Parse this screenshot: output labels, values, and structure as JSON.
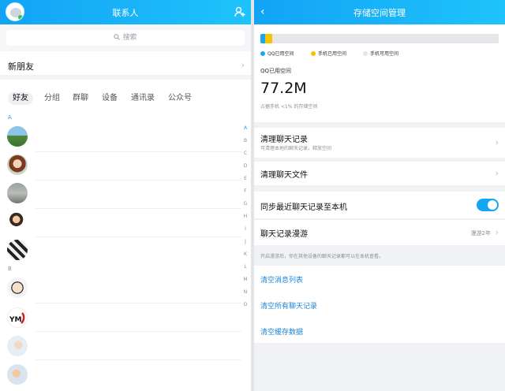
{
  "contacts": {
    "title": "联系人",
    "search_placeholder": "搜索",
    "new_friends": "新朋友",
    "tabs": [
      "好友",
      "分组",
      "群聊",
      "设备",
      "通讯录",
      "公众号"
    ],
    "sections": [
      "A",
      "B"
    ],
    "index_letters": [
      "A",
      "B",
      "C",
      "D",
      "E",
      "F",
      "G",
      "H",
      "I",
      "J",
      "K",
      "L",
      "M",
      "N",
      "O"
    ]
  },
  "storage": {
    "title": "存储空间管理",
    "legend": [
      "QQ已用空间",
      "手机已用空间",
      "手机可用空间"
    ],
    "usage": {
      "qq_fraction": 0.02,
      "phone_used_fraction": 0.03
    },
    "colors": {
      "qq": "#1aa7f2",
      "phone_used": "#f5c400",
      "phone_free": "#e4e6e9"
    },
    "qq_used_label": "QQ已用空间",
    "qq_used_value": "77.2M",
    "qq_used_note": "占据手机 <1% 的存储空间",
    "clear_chat_records": {
      "title": "清理聊天记录",
      "subtitle": "可清理本地的聊天记录，释放空间"
    },
    "clear_chat_files": {
      "title": "清理聊天文件"
    },
    "sync_recent": {
      "title": "同步最近聊天记录至本机",
      "enabled": true
    },
    "roaming": {
      "title": "聊天记录漫游",
      "value": "漫游2年"
    },
    "roaming_note": "开启漫游后，你在其他设备的聊天记录都可以在本机查看。",
    "actions": [
      "清空消息列表",
      "清空所有聊天记录",
      "清空缓存数据"
    ]
  }
}
